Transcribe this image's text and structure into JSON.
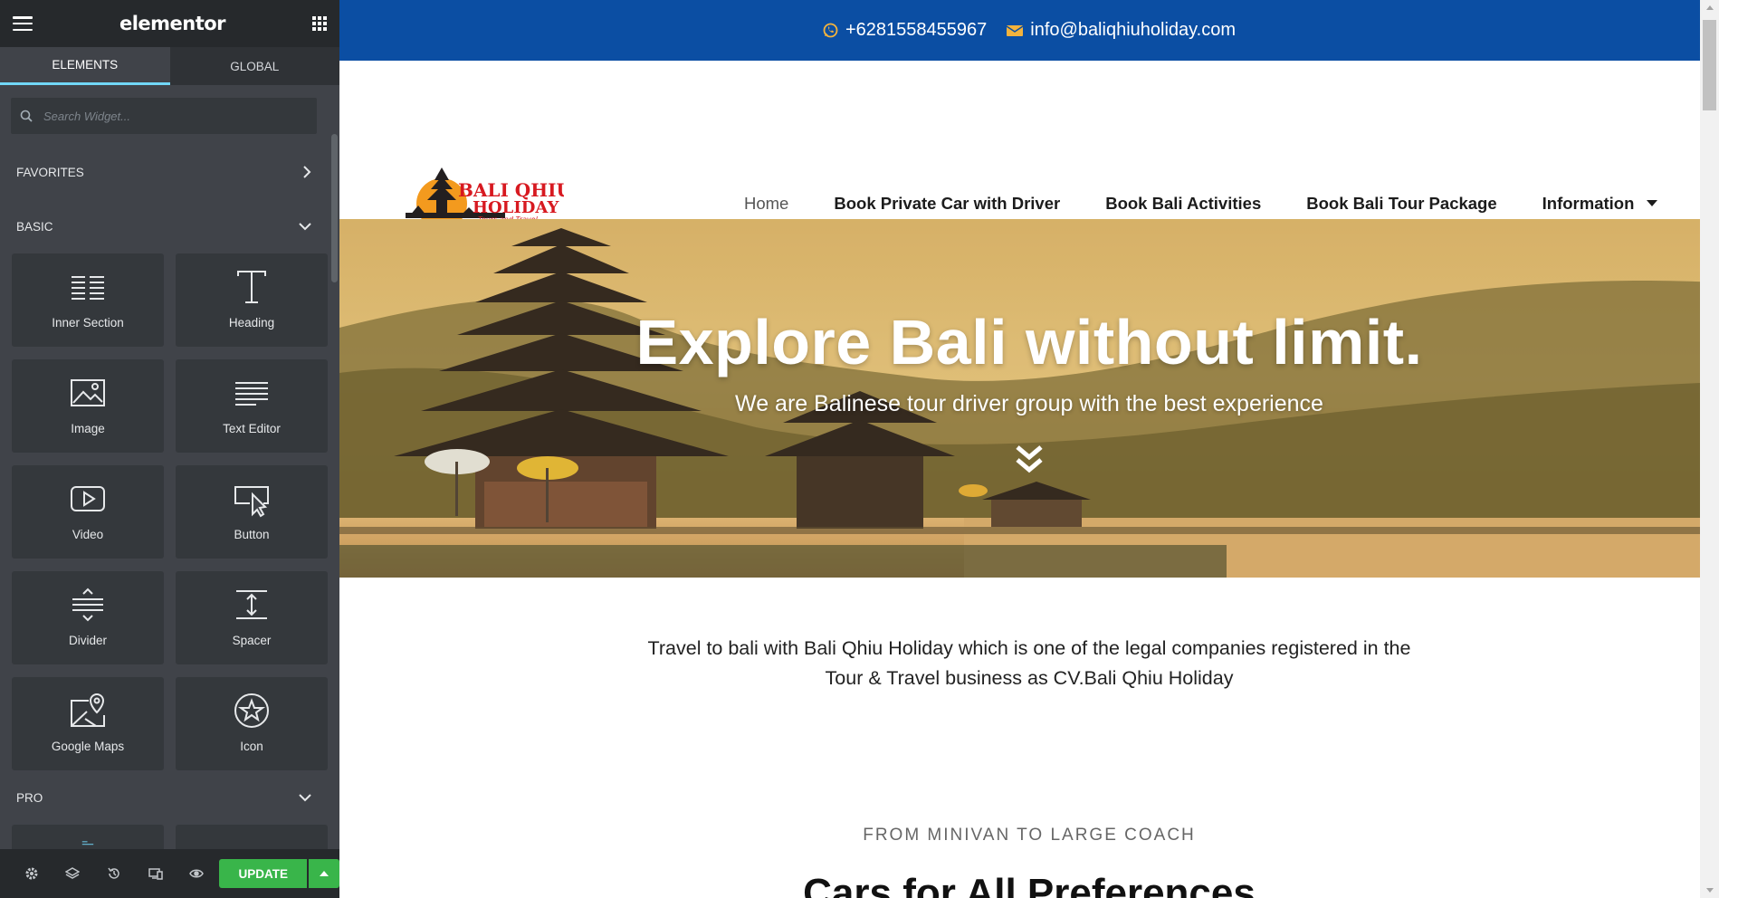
{
  "panel": {
    "brand": "elementor",
    "tabs": [
      {
        "label": "ELEMENTS",
        "active": true
      },
      {
        "label": "GLOBAL",
        "active": false
      }
    ],
    "search": {
      "placeholder": "Search Widget..."
    },
    "categories": {
      "favorites": "FAVORITES",
      "basic": "BASIC",
      "pro": "PRO"
    },
    "widgets": [
      {
        "label": "Inner Section",
        "icon": "inner-section-icon"
      },
      {
        "label": "Heading",
        "icon": "heading-icon"
      },
      {
        "label": "Image",
        "icon": "image-icon"
      },
      {
        "label": "Text Editor",
        "icon": "text-editor-icon"
      },
      {
        "label": "Video",
        "icon": "video-icon"
      },
      {
        "label": "Button",
        "icon": "button-icon"
      },
      {
        "label": "Divider",
        "icon": "divider-icon"
      },
      {
        "label": "Spacer",
        "icon": "spacer-icon"
      },
      {
        "label": "Google Maps",
        "icon": "google-maps-icon"
      },
      {
        "label": "Icon",
        "icon": "icon-widget-icon"
      }
    ],
    "footer": {
      "update_label": "UPDATE",
      "icons": [
        "settings-icon",
        "layers-icon",
        "history-icon",
        "responsive-icon",
        "preview-icon"
      ]
    },
    "colors": {
      "panel_bg": "#404349",
      "header_bg": "#26292c",
      "active_tab_underline": "#71d7f7",
      "update_green": "#39b54a"
    }
  },
  "site": {
    "topbar": {
      "phone": "+6281558455967",
      "email": "info@baliqhiuholiday.com",
      "bg": "#0b4ea3"
    },
    "logo": {
      "line1": "BALI QHIU",
      "line2": "HOLIDAY",
      "tagline": "Tours and Travel"
    },
    "menu": [
      {
        "label": "Home",
        "active": true
      },
      {
        "label": "Book Private Car with Driver",
        "active": false
      },
      {
        "label": "Book Bali Activities",
        "active": false
      },
      {
        "label": "Book Bali Tour Package",
        "active": false
      },
      {
        "label": "Information",
        "active": false,
        "dropdown": true
      }
    ],
    "hero": {
      "title": "Explore Bali without limit.",
      "subtitle": "We are Balinese tour driver group with the best experience"
    },
    "intro": {
      "line1": "Travel to bali with Bali Qhiu Holiday which is one of the legal companies registered in the",
      "line2": "Tour & Travel business as CV.Bali Qhiu Holiday"
    },
    "section": {
      "kicker": "FROM MINIVAN TO LARGE COACH",
      "title": "Cars for All Preferences"
    },
    "accent": "#f3b33d"
  }
}
